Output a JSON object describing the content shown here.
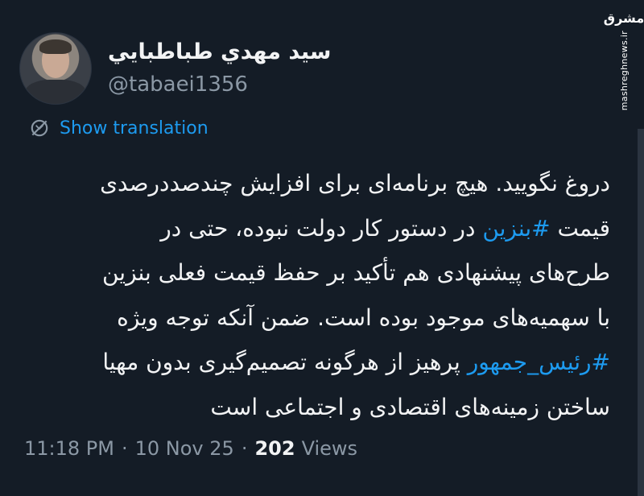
{
  "author": {
    "display_name": "سيد مهدي طباطبايي",
    "handle": "@tabaei1356"
  },
  "watermark": {
    "logo_text": "مشرق",
    "site": "mashreghnews.ir"
  },
  "translation": {
    "icon": "globe-icon",
    "label": "Show translation"
  },
  "tweet": {
    "line1": "دروغ نگویید. هیچ برنامه‌ای برای افزایش چندصددرصدی",
    "line2_pre": "قیمت ",
    "line2_hashtag": "#بنزین",
    "line2_post": " در دستور کار دولت نبوده، حتی در",
    "line3": "طرح‌های پیشنهادی هم تأکید بر حفظ قیمت فعلی بنزین",
    "line4": "با سهمیه‌های موجود بوده است. ضمن آنکه توجه ویژه",
    "line5_hashtag": "#رئیس_جمهور",
    "line5_post": " پرهیز از هرگونه تصمیم‌گیری بدون مهیا",
    "line6": "ساختن زمینه‌های اقتصادی و اجتماعی است"
  },
  "meta": {
    "time": "11:18 PM",
    "date": "10 Nov 25",
    "separator": "·",
    "views_count": "202",
    "views_label": "Views"
  },
  "colors": {
    "background": "#141c26",
    "link": "#1d9bf0",
    "secondary_text": "#8b98a5"
  }
}
